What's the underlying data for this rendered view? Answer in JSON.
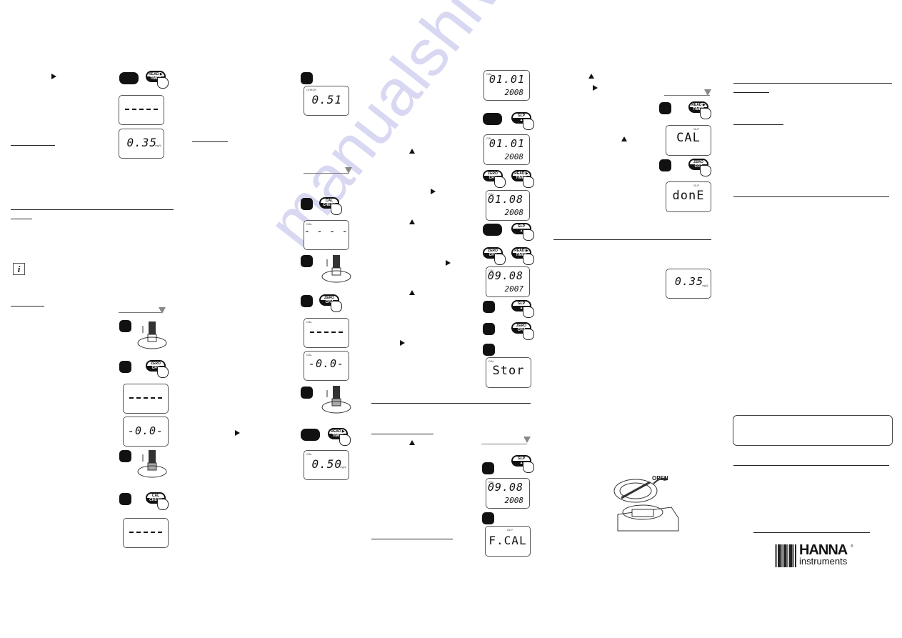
{
  "page": {
    "watermark": "manualshive.com"
  },
  "keys": {
    "read_timer": {
      "top": "READ ▶",
      "bottom": "TIMER"
    },
    "zero_cfm": {
      "top": "ZERO",
      "bottom": "CFM"
    },
    "cal_check": {
      "top": "CAL",
      "bottom": "CHECK"
    },
    "glp_up": {
      "top": "GLP",
      "bottom": "▲"
    }
  },
  "column1": {
    "lcd_read_result": "0.35",
    "lcd_cal_check_zero": "-0.0-"
  },
  "column2": {
    "lcd_check_result": "0.51",
    "lcd_zero_dashes": "- - - -",
    "lcd_cal_zero": "-0.0-",
    "lcd_cal_result": "0.50"
  },
  "column3": {
    "lcd_date_1": {
      "main": "01.01",
      "year": "2008"
    },
    "lcd_date_2": {
      "main": "01.01",
      "year": "2008"
    },
    "lcd_date_3": {
      "main": "01.08",
      "year": "2008"
    },
    "lcd_date_4": {
      "main": "09.08",
      "year": "2007"
    },
    "lcd_stor": "Stor",
    "lcd_date_5": {
      "main": "09.08",
      "year": "2008"
    },
    "lcd_fcal": "F.CAL"
  },
  "column4": {
    "lcd_cal": "CAL",
    "lcd_done": "donE",
    "lcd_reading": "0.35",
    "open_label": "OPEN"
  },
  "logo": {
    "brand": "HANNA",
    "sub": "instruments",
    "reg": "®"
  },
  "info_icon": "i"
}
